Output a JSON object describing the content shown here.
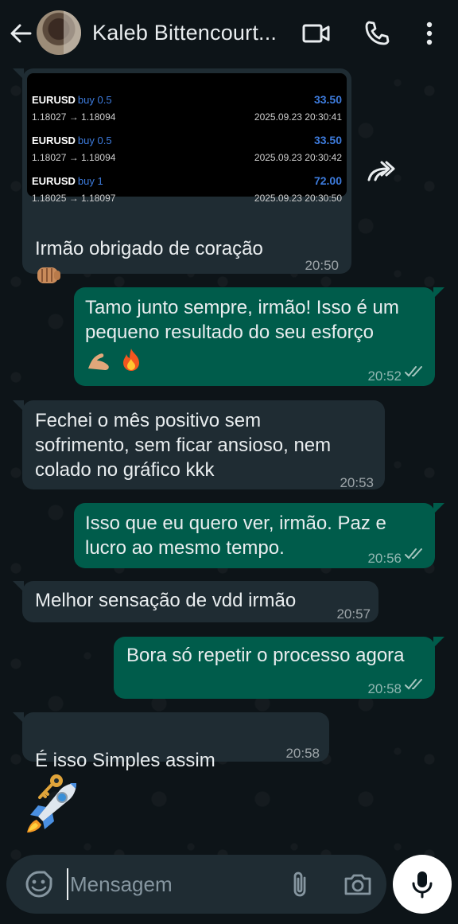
{
  "header": {
    "contact_name": "Kaleb Bittencourt...",
    "icons": [
      "back-arrow-icon",
      "video-call-icon",
      "phone-call-icon",
      "more-vert-icon"
    ]
  },
  "trade_image": {
    "rows": [
      {
        "symbol": "EURUSD",
        "side": "buy 0.5",
        "profit": "33.50",
        "prices": "1.18027 → 1.18094",
        "timestamp": "2025.09.23 20:30:41"
      },
      {
        "symbol": "EURUSD",
        "side": "buy 0.5",
        "profit": "33.50",
        "prices": "1.18027 → 1.18094",
        "timestamp": "2025.09.23 20:30:42"
      },
      {
        "symbol": "EURUSD",
        "side": "buy 1",
        "profit": "72.00",
        "prices": "1.18025 → 1.18097",
        "timestamp": "2025.09.23 20:30:50"
      }
    ]
  },
  "messages": [
    {
      "direction": "in",
      "text": "Irmão obrigado de coração",
      "emoji": "fist-bump-icon",
      "time": "20:50"
    },
    {
      "direction": "out",
      "text": "Tamo junto sempre, irmão! Isso é um\npequeno resultado do seu esforço",
      "emoji": "muscle-fire-icons",
      "time": "20:52",
      "status": "read"
    },
    {
      "direction": "in",
      "text": "Fechei o mês positivo sem\nsofrimento, sem ficar ansioso, nem\ncolado no gráfico kkk",
      "time": "20:53"
    },
    {
      "direction": "out",
      "text": "Isso que eu quero ver, irmão. Paz e\nlucro ao mesmo tempo.",
      "time": "20:56",
      "status": "read"
    },
    {
      "direction": "in",
      "text": "Melhor sensação de vdd irmão",
      "time": "20:57"
    },
    {
      "direction": "out",
      "text": "Bora só repetir o processo agora",
      "time": "20:58",
      "status": "read"
    },
    {
      "direction": "in",
      "text": "É isso Simples assim",
      "emoji": "key-icon",
      "time": "20:58"
    },
    {
      "direction": "in",
      "emoji": "rocket-icon"
    }
  ],
  "composer": {
    "placeholder": "Mensagem",
    "icons": [
      "sticker-icon",
      "attach-icon",
      "camera-icon",
      "mic-icon"
    ]
  },
  "colors": {
    "incoming": "#1f2c33",
    "outgoing": "#005c4b",
    "background": "#0b141a",
    "profit_blue": "#3d7bdc"
  }
}
